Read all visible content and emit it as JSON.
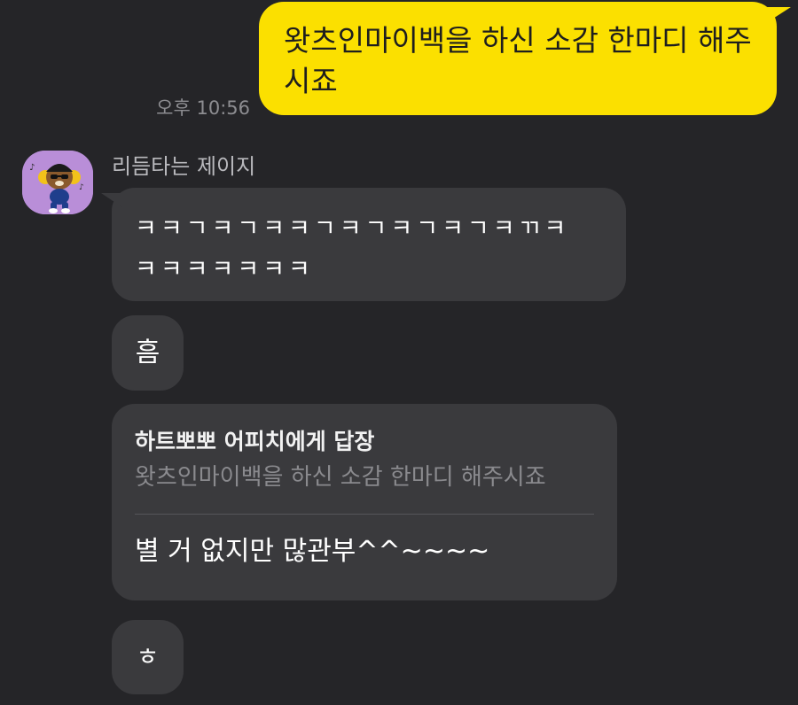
{
  "chat": {
    "outgoing": {
      "text_line1": "왓츠인마이백을 하신 소감 한마디 해주",
      "text_line2": "시죠",
      "time": "오후 10:56"
    },
    "sender": {
      "name": "리듬타는 제이지",
      "avatar_icon": "character-avatar-icon"
    },
    "messages": {
      "m1_line1": "ㅋㅋㄱㅋㄱㅋㅋㄱㅋㄱㅋㄱㅋㄱㅋㄲㅋ",
      "m1_line2": "ㅋㅋㅋㅋㅋㅋㅋ",
      "m2": "흠",
      "m3_reply_title": "하트뽀뽀 어피치에게 답장",
      "m3_reply_quote": "왓츠인마이백을 하신 소감 한마디 해주시죠",
      "m3_body": "별 거 없지만 많관부^^~~~~",
      "m4": "ㅎ"
    }
  },
  "colors": {
    "background": "#252528",
    "outgoing_bubble": "#fbe000",
    "incoming_bubble": "#3a3a3d",
    "avatar_bg": "#b98ed8"
  }
}
